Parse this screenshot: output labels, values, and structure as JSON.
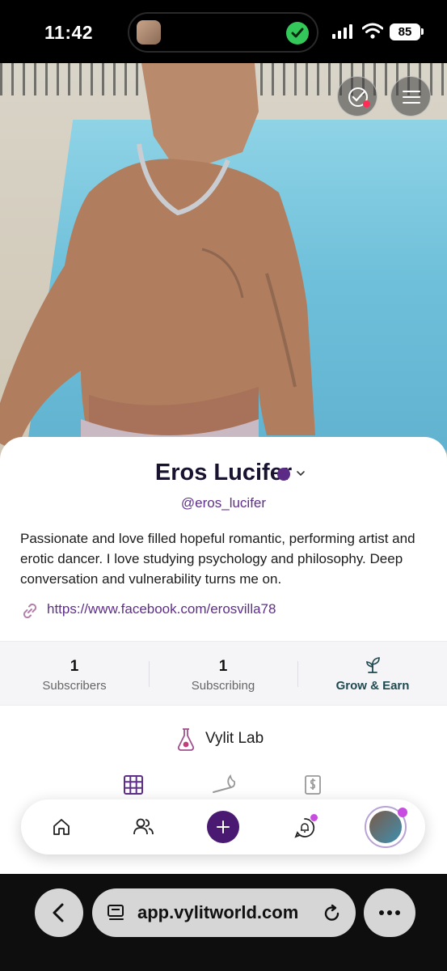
{
  "status_bar": {
    "time": "11:42",
    "battery": "85"
  },
  "profile": {
    "name": "Eros Lucifer",
    "handle": "@eros_lucifer",
    "bio": "Passionate and love filled hopeful romantic, performing artist and erotic dancer. I love studying psychology and philosophy. Deep conversation and vulnerability turns me on.",
    "link": "https://www.facebook.com/erosvilla78"
  },
  "stats": [
    {
      "value": "1",
      "label": "Subscribers"
    },
    {
      "value": "1",
      "label": "Subscribing"
    }
  ],
  "grow": {
    "label": "Grow & Earn"
  },
  "lab": {
    "label": "Vylit Lab"
  },
  "browser": {
    "url": "app.vylitworld.com"
  },
  "colors": {
    "accent": "#4a1a72",
    "link": "#5e2e8a",
    "grow": "#1e4a50",
    "notification": "#c64de0"
  },
  "icons": {
    "hero": [
      "checkmark-circle-icon",
      "menu-icon"
    ],
    "tabs": [
      "grid-icon",
      "flame-icon",
      "dollar-document-icon"
    ],
    "nav": [
      "home-icon",
      "people-icon",
      "plus-icon",
      "chat-bell-icon",
      "avatar"
    ]
  }
}
